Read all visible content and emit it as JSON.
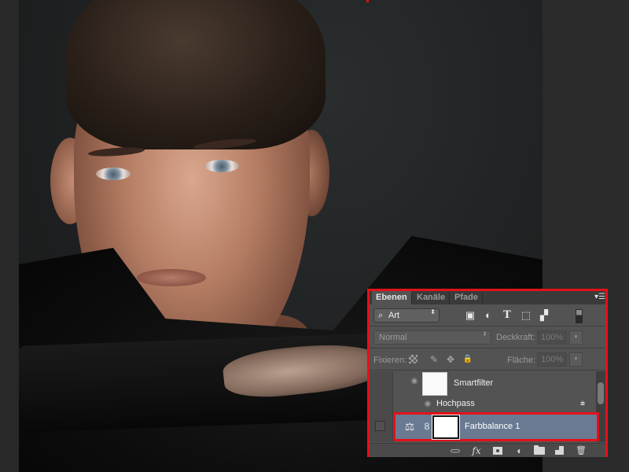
{
  "panel": {
    "tabs": [
      {
        "label": "Ebenen",
        "active": true
      },
      {
        "label": "Kanäle",
        "active": false
      },
      {
        "label": "Pfade",
        "active": false
      }
    ],
    "menu_icon": "panel-menu-icon",
    "filter": {
      "selected": "Art",
      "icons": [
        "image-filter-icon",
        "adjustment-filter-icon",
        "type-filter-icon",
        "shape-filter-icon",
        "smart-object-filter-icon"
      ],
      "toggle_state": "on"
    },
    "blend_mode": "Normal",
    "opacity_label": "Deckkraft:",
    "opacity_value": "100%",
    "lock_label": "Fixieren:",
    "lock_icons": [
      "lock-transparent-pixels-icon",
      "lock-image-pixels-icon",
      "lock-position-icon",
      "lock-all-icon"
    ],
    "fill_label": "Fläche:",
    "fill_value": "100%",
    "layers": [
      {
        "name": "Smartfilter",
        "type": "smart-filter-mask",
        "visible": true
      },
      {
        "name": "Hochpass",
        "type": "filter",
        "visible": true
      },
      {
        "name": "Farbbalance 1",
        "type": "adjustment-color-balance",
        "visible": false,
        "selected": true
      }
    ],
    "bottom_icons": [
      "link-layers-icon",
      "layer-style-fx-icon",
      "add-mask-icon",
      "new-adjustment-layer-icon",
      "new-group-icon",
      "new-layer-icon",
      "delete-layer-icon"
    ],
    "highlight_color": "#e3111a",
    "selection_color": "#6a7a92"
  },
  "glyphs": {
    "search": "⌕",
    "updown": "⬍",
    "menu": "▾☰",
    "image": "▣",
    "adjust": "◐",
    "type": "T",
    "shape": "⬚",
    "smart": "▞",
    "brush": "✎",
    "move": "✥",
    "lock": "🔒",
    "eye": "◉",
    "filter_opts": "⩧",
    "scale": "⚖",
    "chain": "8",
    "link": "⊂⊃",
    "fx": "fx",
    "adjust_layer": "◐",
    "trash": "🗑",
    "dd": "▾"
  }
}
